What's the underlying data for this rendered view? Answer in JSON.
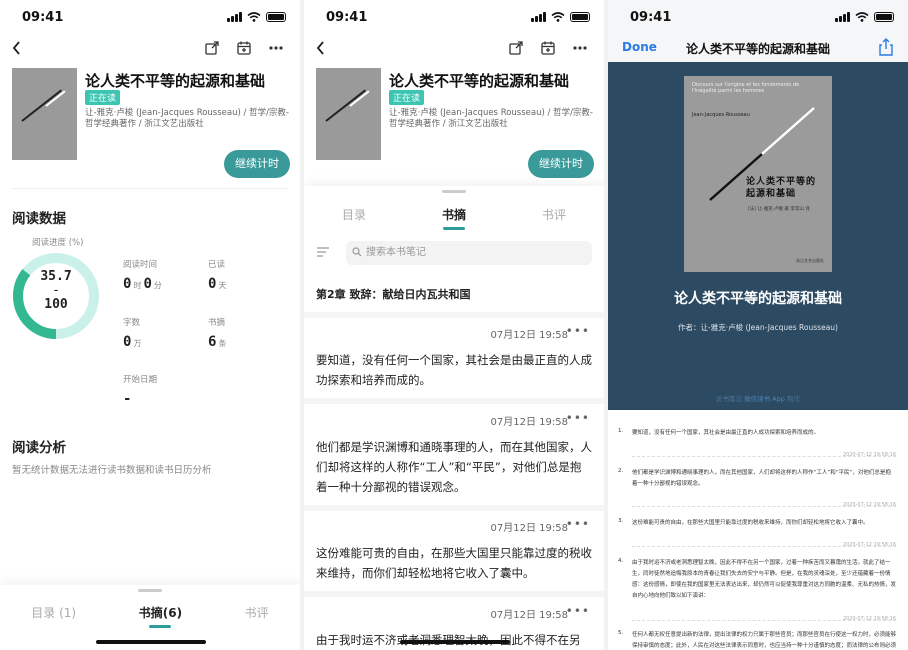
{
  "status_bar": {
    "time": "09:41"
  },
  "book": {
    "title": "论人类不平等的起源和基础",
    "badge": "正在读",
    "meta": "让-雅克·卢梭 (Jean-Jacques Rousseau) / 哲学/宗教-哲学经典著作 / 浙江文艺出版社",
    "cover_title": "论人类不平等的起源和基础",
    "cover_subtitle": "Discours sur l'origine et les fondements de l'inégalité parmi les hommes",
    "cover_author_en": "Jean-Jacques Rousseau",
    "cover_author_zh": "[法] 让-雅克·卢梭 著 李常山 译",
    "cover_publisher": "浙江文艺出版社"
  },
  "continue_button": "继续计时",
  "reading_data": {
    "section_title": "阅读数据",
    "progress_label": "阅读进度 (%)",
    "progress_value": "35.7",
    "progress_dash": "-",
    "progress_total": "100",
    "progress_fraction": 0.357,
    "stats": {
      "time_label": "阅读时间",
      "time_hours": "0",
      "time_hours_unit": "时",
      "time_minutes": "0",
      "time_minutes_unit": "分",
      "read_label": "已读",
      "read_days": "0",
      "read_days_unit": "天",
      "words_label": "字数",
      "words_value": "0",
      "words_unit": "万",
      "excerpts_label": "书摘",
      "excerpts_value": "6",
      "excerpts_unit": "条",
      "start_label": "开始日期",
      "start_value": "-"
    }
  },
  "analysis": {
    "section_title": "阅读分析",
    "empty_text": "暂无统计数据无法进行读书数据和读书日历分析"
  },
  "sheet_tabs": {
    "toc_count": "目录 (1)",
    "excerpts_count": "书摘(6)",
    "review": "书评"
  },
  "notes_tabs": {
    "toc": "目录",
    "excerpts": "书摘",
    "review": "书评"
  },
  "notes_search_placeholder": "搜索本书笔记",
  "notes_chapter": "第2章 致辞：献给日内瓦共和国",
  "notes": [
    {
      "time": "07月12日 19:58",
      "text": "要知道，没有任何一个国家，其社会是由最正直的人成功探索和培养而成的。"
    },
    {
      "time": "07月12日 19:58",
      "text": "他们都是学识渊博和通晓事理的人，而在其他国家，人们却将这样的人称作“工人”和“平民”，对他们总是抱着一种十分鄙视的错误观念。"
    },
    {
      "time": "07月12日 19:58",
      "text": "这份难能可贵的自由，在那些大国里只能靠过度的税收来维持，而你们却轻松地将它收入了囊中。"
    },
    {
      "time": "07月12日 19:58",
      "text": "由于我时运不济或老洞悉理智太晚，因此不得不在另"
    }
  ],
  "export": {
    "done": "Done",
    "title": "论人类不平等的起源和基础",
    "author_line": "作者：让-雅克·卢梭 (Jean-Jacques Rousseau)",
    "made_prefix": "此书笔记",
    "made_app": "微信读书 App",
    "made_suffix": "制作",
    "items": [
      {
        "num": "1.",
        "text": "要知道，没有任何一个国家，其社会是由最正直的人成功探索和培养而成的。",
        "date": "2020-07-12 19:58:16"
      },
      {
        "num": "2.",
        "text": "他们都是学识渊博和通晓事理的人，而在其他国家，人们却将这样的人称作“工人”和“平民”，对他们总是抱着一种十分鄙视的错误观念。",
        "date": "2020-07-12 19:58:16"
      },
      {
        "num": "3.",
        "text": "这份难能可贵的自由，在那些大国里只能靠过度的税收来维持，而你们却轻松地将它收入了囊中。",
        "date": "2020-07-12 19:58:16"
      },
      {
        "num": "4.",
        "text": "由于我时运不济或老洞悉理智太晚，因此不得不在另一个国家，过着一种疾苦而又暮霭的生活。就此了结一生，同时徒然地追悔我原本的青春让我们失去的安宁与平静。但是，在我的灵魂深处，至少还蕴藏着一份情感：这份感情，即使在我的国家里无法表达出来，却仍然可以促使我尊重对这方同胞的温柔、无私的热情，发自内心地向他们致以如下演讲：",
        "date": "2020-07-12 19:58:16"
      },
      {
        "num": "5.",
        "text": "任何人都无权任意提出新的法律，提出法律的权力只属于那些官员；而那些官员在行使这一权力时，必须能够保持审慎的态度；此外，人民在对这些法律表示同意时，也应当持一种十分谨慎的态度；而法律的公布则必须在无比庄严的方式下进行。",
        "date": ""
      }
    ]
  },
  "colors": {
    "accent": "#2f9c9c",
    "badge": "#3cc5b0",
    "export_bg": "#2d4a63",
    "link": "#2a7be4"
  }
}
